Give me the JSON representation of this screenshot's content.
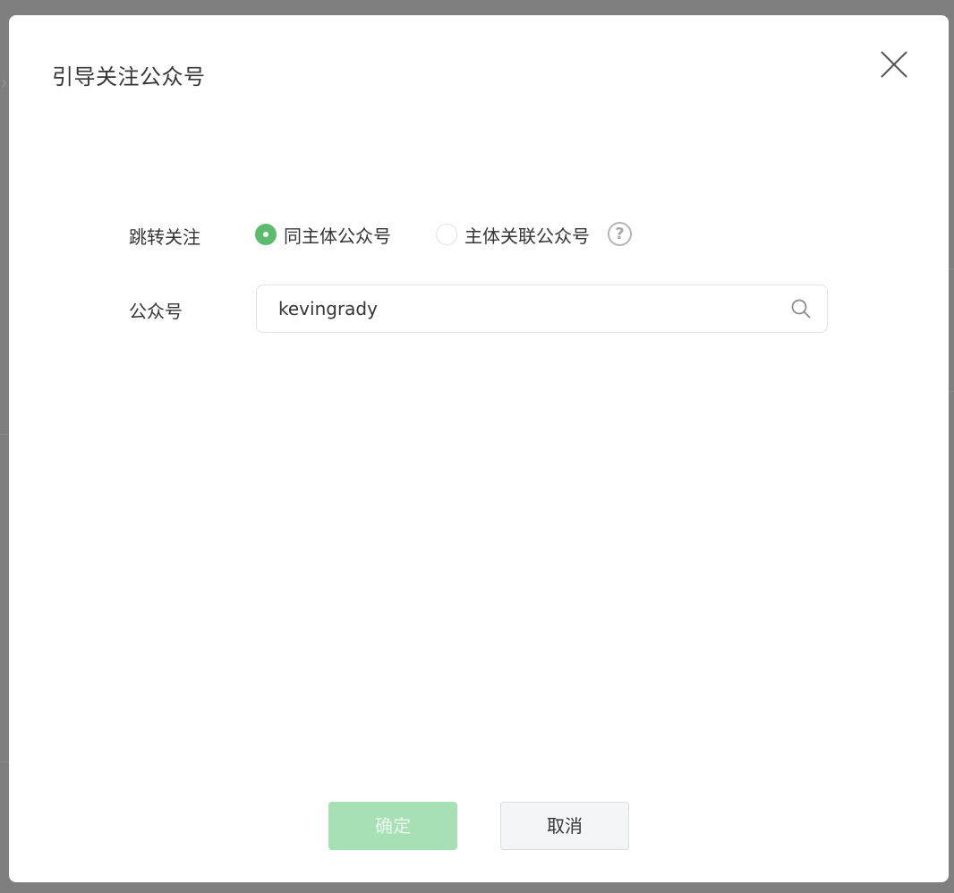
{
  "dialog": {
    "title": "引导关注公众号",
    "close_icon": "close-icon"
  },
  "form": {
    "jump_follow": {
      "label": "跳转关注",
      "options": [
        {
          "label": "同主体公众号",
          "checked": true
        },
        {
          "label": "主体关联公众号",
          "checked": false
        }
      ],
      "help_icon": "question-circle-icon",
      "help_glyph": "?"
    },
    "account": {
      "label": "公众号",
      "value": "kevingrady",
      "search_icon": "search-icon"
    }
  },
  "footer": {
    "confirm_label": "确定",
    "cancel_label": "取消"
  },
  "colors": {
    "accent": "#5dbb6f",
    "confirm_disabled_bg": "#a7e0b5",
    "overlay": "#7f7f7f"
  }
}
